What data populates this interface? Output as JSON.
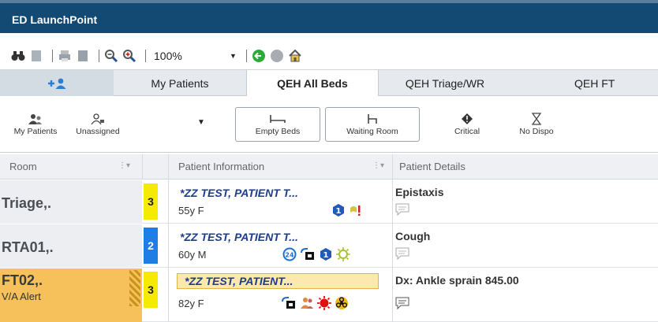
{
  "app": {
    "title": "ED LaunchPoint"
  },
  "toolbar": {
    "zoom_value": "100%",
    "icons": [
      "binoculars-icon",
      "document-icon",
      "print-icon",
      "print-preview-icon",
      "zoom-out-icon",
      "zoom-in-icon",
      "refresh-icon",
      "stop-icon",
      "home-icon"
    ]
  },
  "tabs": [
    {
      "label": ""
    },
    {
      "label": "My Patients"
    },
    {
      "label": "QEH All Beds"
    },
    {
      "label": "QEH Triage/WR"
    },
    {
      "label": "QEH FT"
    }
  ],
  "filters": {
    "my_patients": "My Patients",
    "unassigned": "Unassigned",
    "empty_beds": "Empty Beds",
    "waiting_room": "Waiting Room",
    "critical": "Critical",
    "no_dispo": "No Dispo"
  },
  "columns": {
    "room": "Room",
    "patient_info": "Patient Information",
    "patient_details": "Patient Details"
  },
  "colors": {
    "title_bg": "#124a74",
    "acuity3": "#f5ea00",
    "acuity2": "#1e7ee6",
    "name_blue": "#1e3c8a",
    "alert_orange": "#f6c05a"
  },
  "rows": [
    {
      "room": "Triage,.",
      "alert": "",
      "acuity": "3",
      "name": "*ZZ TEST, PATIENT T...",
      "demo": "55y F",
      "details": "Epistaxis"
    },
    {
      "room": "RTA01,.",
      "alert": "",
      "acuity": "2",
      "name": "*ZZ TEST, PATIENT T...",
      "demo": "60y M",
      "details": "Cough"
    },
    {
      "room": "FT02,.",
      "alert": "V/A Alert",
      "acuity": "3",
      "name": "*ZZ TEST, PATIENT...",
      "demo": "82y F",
      "details": "Dx: Ankle sprain 845.00"
    }
  ]
}
